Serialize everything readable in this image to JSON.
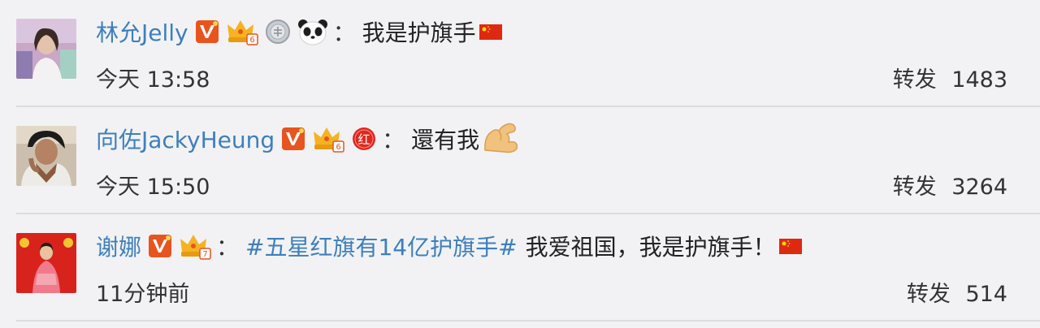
{
  "rows": [
    {
      "username": "林允Jelly",
      "comment": "我是护旗手",
      "time": "今天 13:58",
      "repost_label": "转发",
      "repost_count": "1483"
    },
    {
      "username": "向佐JackyHeung",
      "comment": "還有我",
      "time": "今天 15:50",
      "repost_label": "转发",
      "repost_count": "3264"
    },
    {
      "username": "谢娜",
      "topic": "#五星红旗有14亿护旗手#",
      "comment": "我爱祖国，我是护旗手！",
      "time": "11分钟前",
      "repost_label": "转发",
      "repost_count": "514"
    }
  ],
  "colon": "：",
  "badge_text": {
    "verified": "V",
    "red_badge": "红"
  },
  "icons": {
    "verified": "verified-v-icon",
    "crown": "crown-badge-icon",
    "medal": "silver-medal-icon",
    "panda": "panda-icon",
    "red_badge": "red-badge-icon",
    "flag": "china-flag-icon",
    "arm": "flexed-biceps-icon"
  },
  "colors": {
    "link": "#3d7fbe",
    "verified": "#e8541e",
    "crown": "#f5b323",
    "background": "#f2f2f4",
    "flag": "#de2910"
  }
}
